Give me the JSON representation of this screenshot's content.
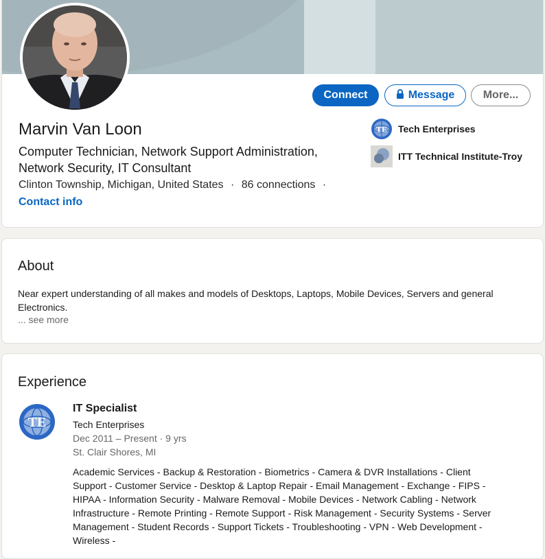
{
  "profile": {
    "name": "Marvin Van Loon",
    "headline": "Computer Technician, Network Support Administration, Network Security, IT Consultant",
    "location": "Clinton Township, Michigan, United States",
    "separator": "·",
    "connections": "86 connections",
    "contact_info": "Contact info"
  },
  "actions": {
    "connect": "Connect",
    "message": "Message",
    "more": "More..."
  },
  "side": {
    "company": "Tech Enterprises",
    "school": "ITT Technical Institute-Troy"
  },
  "about": {
    "title": "About",
    "text": "Near expert understanding of all makes and models of Desktops, Laptops, Mobile Devices, Servers and general Electronics.",
    "see_more": "... see more"
  },
  "experience": {
    "title": "Experience",
    "items": [
      {
        "title": "IT Specialist",
        "company": "Tech Enterprises",
        "dates": "Dec 2011 – Present · 9 yrs",
        "location": "St. Clair Shores, MI",
        "description": "Academic Services - Backup & Restoration - Biometrics - Camera & DVR Installations - Client Support - Customer Service - Desktop & Laptop Repair - Email Management - Exchange - FIPS - HIPAA - Information Security - Malware Removal - Mobile Devices - Network Cabling - Network Infrastructure - Remote Printing - Remote Support - Risk Management - Security Systems - Server Management - Student Records - Support Tickets - Troubleshooting - VPN - Web Development -Wireless -"
      }
    ]
  },
  "colors": {
    "primary": "#0a66c2",
    "banner": "#a3b7bc"
  },
  "icons": {
    "lock": "lock-icon",
    "company_logo": "tech-enterprises-logo",
    "school_logo": "itt-logo"
  }
}
